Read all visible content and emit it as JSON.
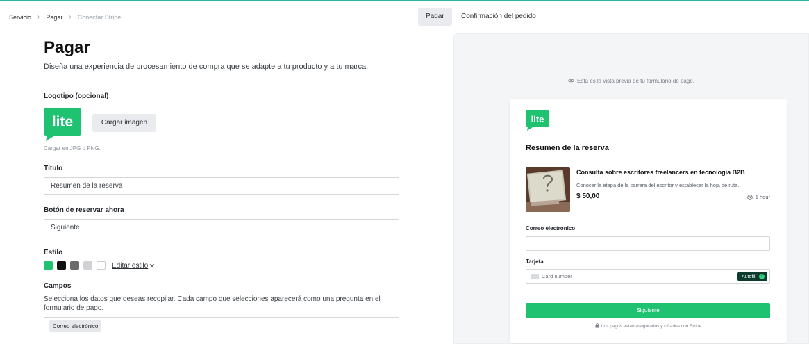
{
  "breadcrumb": {
    "items": [
      "Servicio",
      "Pagar",
      "Conectar Stripe"
    ]
  },
  "tabs": [
    {
      "label": "Pagar",
      "active": true
    },
    {
      "label": "Confirmación del pedido",
      "active": false
    }
  ],
  "form": {
    "title": "Pagar",
    "subtitle": "Diseña una experiencia de procesamiento de compra que se adapte a tu producto y a tu marca.",
    "logo": {
      "label": "Logotipo (opcional)",
      "logo_text": "lite",
      "upload_label": "Cargar imagen",
      "hint": "Cargar en JPG o PNG."
    },
    "title_field": {
      "label": "Título",
      "value": "Resumen de la reserva"
    },
    "book_button_field": {
      "label": "Botón de reservar ahora",
      "value": "Siguiente"
    },
    "style": {
      "label": "Estilo",
      "swatches": [
        "#1ec270",
        "#111111",
        "#6b6b6b",
        "#d0d2d5",
        "#ffffff"
      ],
      "edit_label": "Editar estilo"
    },
    "fields": {
      "label": "Campos",
      "description": "Selecciona los datos que deseas recopilar. Cada campo que selecciones aparecerá como una pregunta en el formulario de pago.",
      "chips": [
        "Correo electrónico"
      ]
    }
  },
  "preview": {
    "note": "Esta es la vista previa de tu formulario de pago.",
    "logo_text": "lite",
    "title": "Resumen de la reserva",
    "product": {
      "name": "Consulta sobre escritores freelancers en tecnología B2B",
      "description": "Conocer la etapa de la carrera del escritor y establecer la hoja de ruta.",
      "price": "$ 50,00",
      "duration": "1 hour"
    },
    "email_label": "Correo electrónico",
    "card_label": "Tarjeta",
    "card_placeholder": "Card number",
    "autofill_label": "Autofill",
    "next_label": "Siguiente",
    "secure_note": "Los pagos están asegurados y cifrados con Stripe"
  },
  "colors": {
    "accent": "#1ec270",
    "topline": "#2bb3a3"
  }
}
